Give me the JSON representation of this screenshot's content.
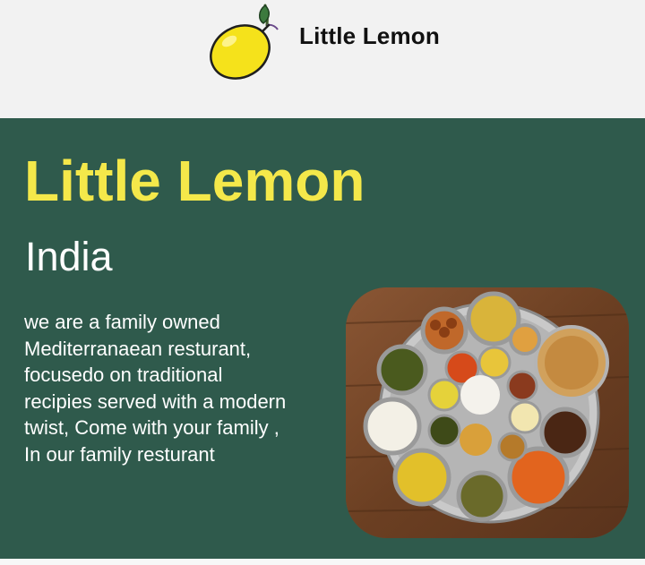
{
  "header": {
    "brand": "Little Lemon",
    "logo_icon": "lemon-icon"
  },
  "hero": {
    "title": "Little Lemon",
    "subtitle": "India",
    "description_lines": [
      "we are a family owned",
      "Mediterranaean resturant,",
      "focusedo on traditional",
      "recipies served with a modern",
      "twist, Come with your family ,",
      "In our family resturant"
    ],
    "image_icon": "food-platter-image"
  },
  "colors": {
    "header_bg": "#f2f2f2",
    "hero_bg": "#2f5a4c",
    "accent_yellow": "#f4e84a",
    "text_white": "#ffffff"
  }
}
